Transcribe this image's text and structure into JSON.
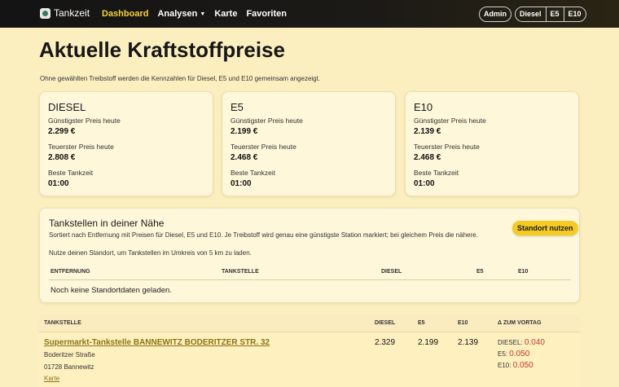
{
  "navbar": {
    "brand": "Tankzeit",
    "links": [
      {
        "label": "Dashboard",
        "active": true
      },
      {
        "label": "Analysen",
        "dropdown": true
      },
      {
        "label": "Karte"
      },
      {
        "label": "Favoriten"
      }
    ],
    "admin_label": "Admin",
    "fuel_buttons": [
      "Diesel",
      "E5",
      "E10"
    ]
  },
  "page": {
    "title": "Aktuelle Kraftstoffpreise",
    "intro": "Ohne gewählten Treibstoff werden die Kennzahlen für Diesel, E5 und E10 gemeinsam angezeigt."
  },
  "cards": [
    {
      "title": "DIESEL",
      "cheapest_label": "Günstigster Preis heute",
      "cheapest": "2.299 €",
      "priciest_label": "Teuerster Preis heute",
      "priciest": "2.808 €",
      "best_label": "Beste Tankzeit",
      "best": "01:00"
    },
    {
      "title": "E5",
      "cheapest_label": "Günstigster Preis heute",
      "cheapest": "2.199 €",
      "priciest_label": "Teuerster Preis heute",
      "priciest": "2.468 €",
      "best_label": "Beste Tankzeit",
      "best": "01:00"
    },
    {
      "title": "E10",
      "cheapest_label": "Günstigster Preis heute",
      "cheapest": "2.139 €",
      "priciest_label": "Teuerster Preis heute",
      "priciest": "2.468 €",
      "best_label": "Beste Tankzeit",
      "best": "01:00"
    }
  ],
  "nearby": {
    "title": "Tankstellen in deiner Nähe",
    "description": "Sortiert nach Entfernung mit Preisen für Diesel, E5 und E10. Je Treibstoff wird genau eine günstigste Station markiert; bei gleichem Preis die nähere.",
    "hint": "Nutze deinen Standort, um Tankstellen im Umkreis von 5 km zu laden.",
    "button": "Standort nutzen",
    "columns": [
      "ENTFERNUNG",
      "TANKSTELLE",
      "DIESEL",
      "E5",
      "E10"
    ],
    "empty": "Noch keine Standortdaten geladen."
  },
  "stations": {
    "columns": [
      "TANKSTELLE",
      "DIESEL",
      "E5",
      "E10",
      "Δ ZUM VORTAG"
    ],
    "rows": [
      {
        "name": "Supermarkt-Tankstelle BANNEWITZ BODERITZER STR. 32",
        "street": "Boderitzer Straße",
        "city": "01728 Bannewitz",
        "map_link": "Karte",
        "diesel": "2.329",
        "e5": "2.199",
        "e10": "2.139",
        "delta": [
          {
            "label": "DIESEL:",
            "value": "0.040"
          },
          {
            "label": "E5:",
            "value": "0.050"
          },
          {
            "label": "E10:",
            "value": "0.050"
          }
        ]
      }
    ]
  }
}
